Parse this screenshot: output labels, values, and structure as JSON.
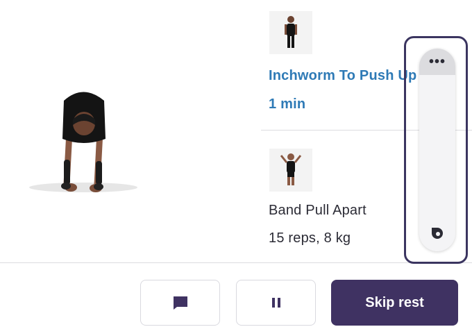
{
  "exercises": [
    {
      "name": "Inchworm To Push Up",
      "detail": "1 min",
      "state": "current"
    },
    {
      "name": "Band Pull Apart",
      "detail": "15 reps, 8 kg",
      "state": "upcoming"
    }
  ],
  "actions": {
    "skip_label": "Skip rest"
  },
  "overlay": {
    "menu_glyph": "•••"
  },
  "colors": {
    "accent_blue": "#2e7ab6",
    "primary_button": "#3f3262",
    "overlay_frame": "#3b3560"
  },
  "icons": [
    "chat-bubble-icon",
    "pause-icon",
    "more-options-icon",
    "bixby-icon"
  ]
}
